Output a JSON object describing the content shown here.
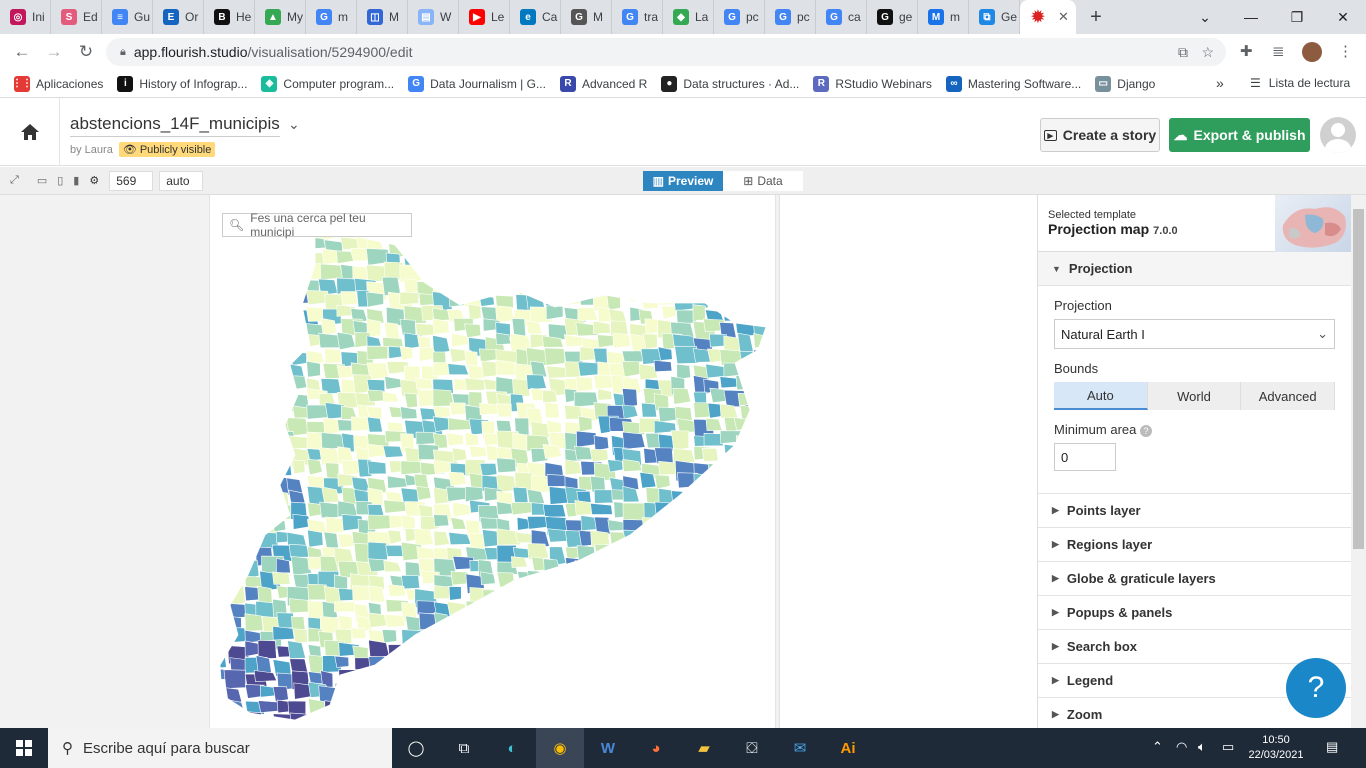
{
  "browser": {
    "tabs": [
      {
        "label": "Ini",
        "color": "#c2185b",
        "glyph": "◎"
      },
      {
        "label": "Ed",
        "color": "#e35c7e",
        "glyph": "S"
      },
      {
        "label": "Gu",
        "color": "#4285f4",
        "glyph": "≡"
      },
      {
        "label": "Or",
        "color": "#1565c0",
        "glyph": "E"
      },
      {
        "label": "He",
        "color": "#111111",
        "glyph": "B"
      },
      {
        "label": "My",
        "color": "#34a853",
        "glyph": "▲"
      },
      {
        "label": "m",
        "color": "#4285f4",
        "glyph": "G"
      },
      {
        "label": "M",
        "color": "#3367d6",
        "glyph": "◫"
      },
      {
        "label": "W",
        "color": "#8ab4f8",
        "glyph": "▤"
      },
      {
        "label": "Le",
        "color": "#ff0000",
        "glyph": "▶"
      },
      {
        "label": "Ca",
        "color": "#0079c1",
        "glyph": "e"
      },
      {
        "label": "M",
        "color": "#555555",
        "glyph": "G"
      },
      {
        "label": "tra",
        "color": "#4285f4",
        "glyph": "G"
      },
      {
        "label": "La",
        "color": "#34a853",
        "glyph": "◆"
      },
      {
        "label": "pc",
        "color": "#4285f4",
        "glyph": "G"
      },
      {
        "label": "pc",
        "color": "#4285f4",
        "glyph": "G"
      },
      {
        "label": "ca",
        "color": "#4285f4",
        "glyph": "G"
      },
      {
        "label": "ge",
        "color": "#111111",
        "glyph": "G"
      },
      {
        "label": "m",
        "color": "#1a73e8",
        "glyph": "M"
      },
      {
        "label": "Ge",
        "color": "#1e88e5",
        "glyph": "⧉"
      }
    ],
    "url_domain": "app.flourish.studio",
    "url_path": "/visualisation/5294900/edit",
    "bookmarks": [
      {
        "label": "Aplicaciones",
        "color": "#e53935"
      },
      {
        "label": "History of Infograp...",
        "color": "#111111"
      },
      {
        "label": "Computer program...",
        "color": "#1abc9c"
      },
      {
        "label": "Data Journalism | G...",
        "color": "#4285f4"
      },
      {
        "label": "Advanced R",
        "color": "#3949ab"
      },
      {
        "label": "Data structures · Ad...",
        "color": "#222222"
      },
      {
        "label": "RStudio Webinars",
        "color": "#5c6bc0"
      },
      {
        "label": "Mastering Software...",
        "color": "#1565c0"
      },
      {
        "label": "Django",
        "color": "#78909c"
      }
    ],
    "reading_list": "Lista de lectura"
  },
  "header": {
    "title": "abstencions_14F_municipis",
    "byline": "by Laura",
    "visibility": "Publicly visible",
    "create_story": "Create a story",
    "export_publish": "Export & publish"
  },
  "toolbar": {
    "width_value": "569",
    "height_value": "auto",
    "preview_label": "Preview",
    "data_label": "Data"
  },
  "preview": {
    "search_placeholder": "Fes una cerca pel teu municipi",
    "palette": [
      "#f7fcce",
      "#e6f4c0",
      "#c8e9b5",
      "#9ed5bf",
      "#6fbfcc",
      "#4ea4c8",
      "#5583c1",
      "#5667b0",
      "#4d4a92"
    ]
  },
  "settings": {
    "template_label": "Selected template",
    "template_name": "Projection map",
    "template_version": "7.0.0",
    "projection_section": "Projection",
    "projection_label": "Projection",
    "projection_value": "Natural Earth I",
    "bounds_label": "Bounds",
    "bounds_options": [
      "Auto",
      "World",
      "Advanced"
    ],
    "bounds_selected": "Auto",
    "min_area_label": "Minimum area",
    "min_area_value": "0",
    "sections": [
      "Points layer",
      "Regions layer",
      "Globe & graticule layers",
      "Popups & panels",
      "Search box",
      "Legend",
      "Zoom"
    ]
  },
  "taskbar": {
    "search_text": "Escribe aquí para buscar",
    "time": "10:50",
    "date": "22/03/2021"
  }
}
